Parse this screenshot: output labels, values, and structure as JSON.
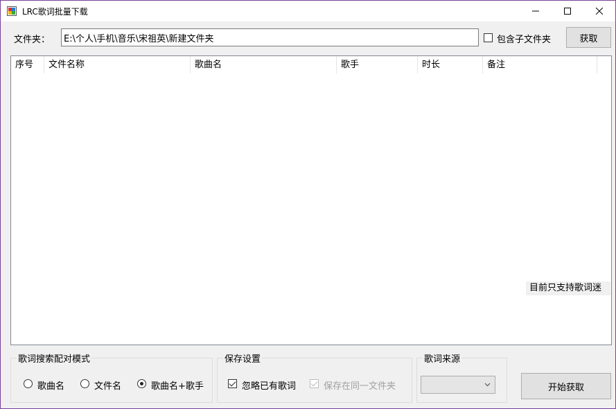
{
  "window": {
    "title": "LRC歌词批量下载"
  },
  "folder": {
    "label": "文件夹：",
    "path": "E:\\个人\\手机\\音乐\\宋祖英\\新建文件夹",
    "include_subfolders_label": "包含子文件夹",
    "include_subfolders": false,
    "fetch_label": "获取"
  },
  "list": {
    "columns": [
      "序号",
      "文件名称",
      "歌曲名",
      "歌手",
      "时长",
      "备注"
    ],
    "hint": "目前只支持歌词迷"
  },
  "match_mode": {
    "title": "歌词搜索配对模式",
    "options": [
      "歌曲名",
      "文件名",
      "歌曲名+歌手"
    ],
    "selected": "歌曲名+歌手"
  },
  "save": {
    "title": "保存设置",
    "ignore_existing_label": "忽略已有歌词",
    "ignore_existing": true,
    "same_folder_label": "保存在同一文件夹",
    "same_folder": true
  },
  "source": {
    "title": "歌词来源",
    "selected": ""
  },
  "start_label": "开始获取",
  "icons": {
    "app": "app-icon",
    "minimize": "minimize-icon",
    "maximize": "maximize-icon",
    "close": "close-icon"
  }
}
